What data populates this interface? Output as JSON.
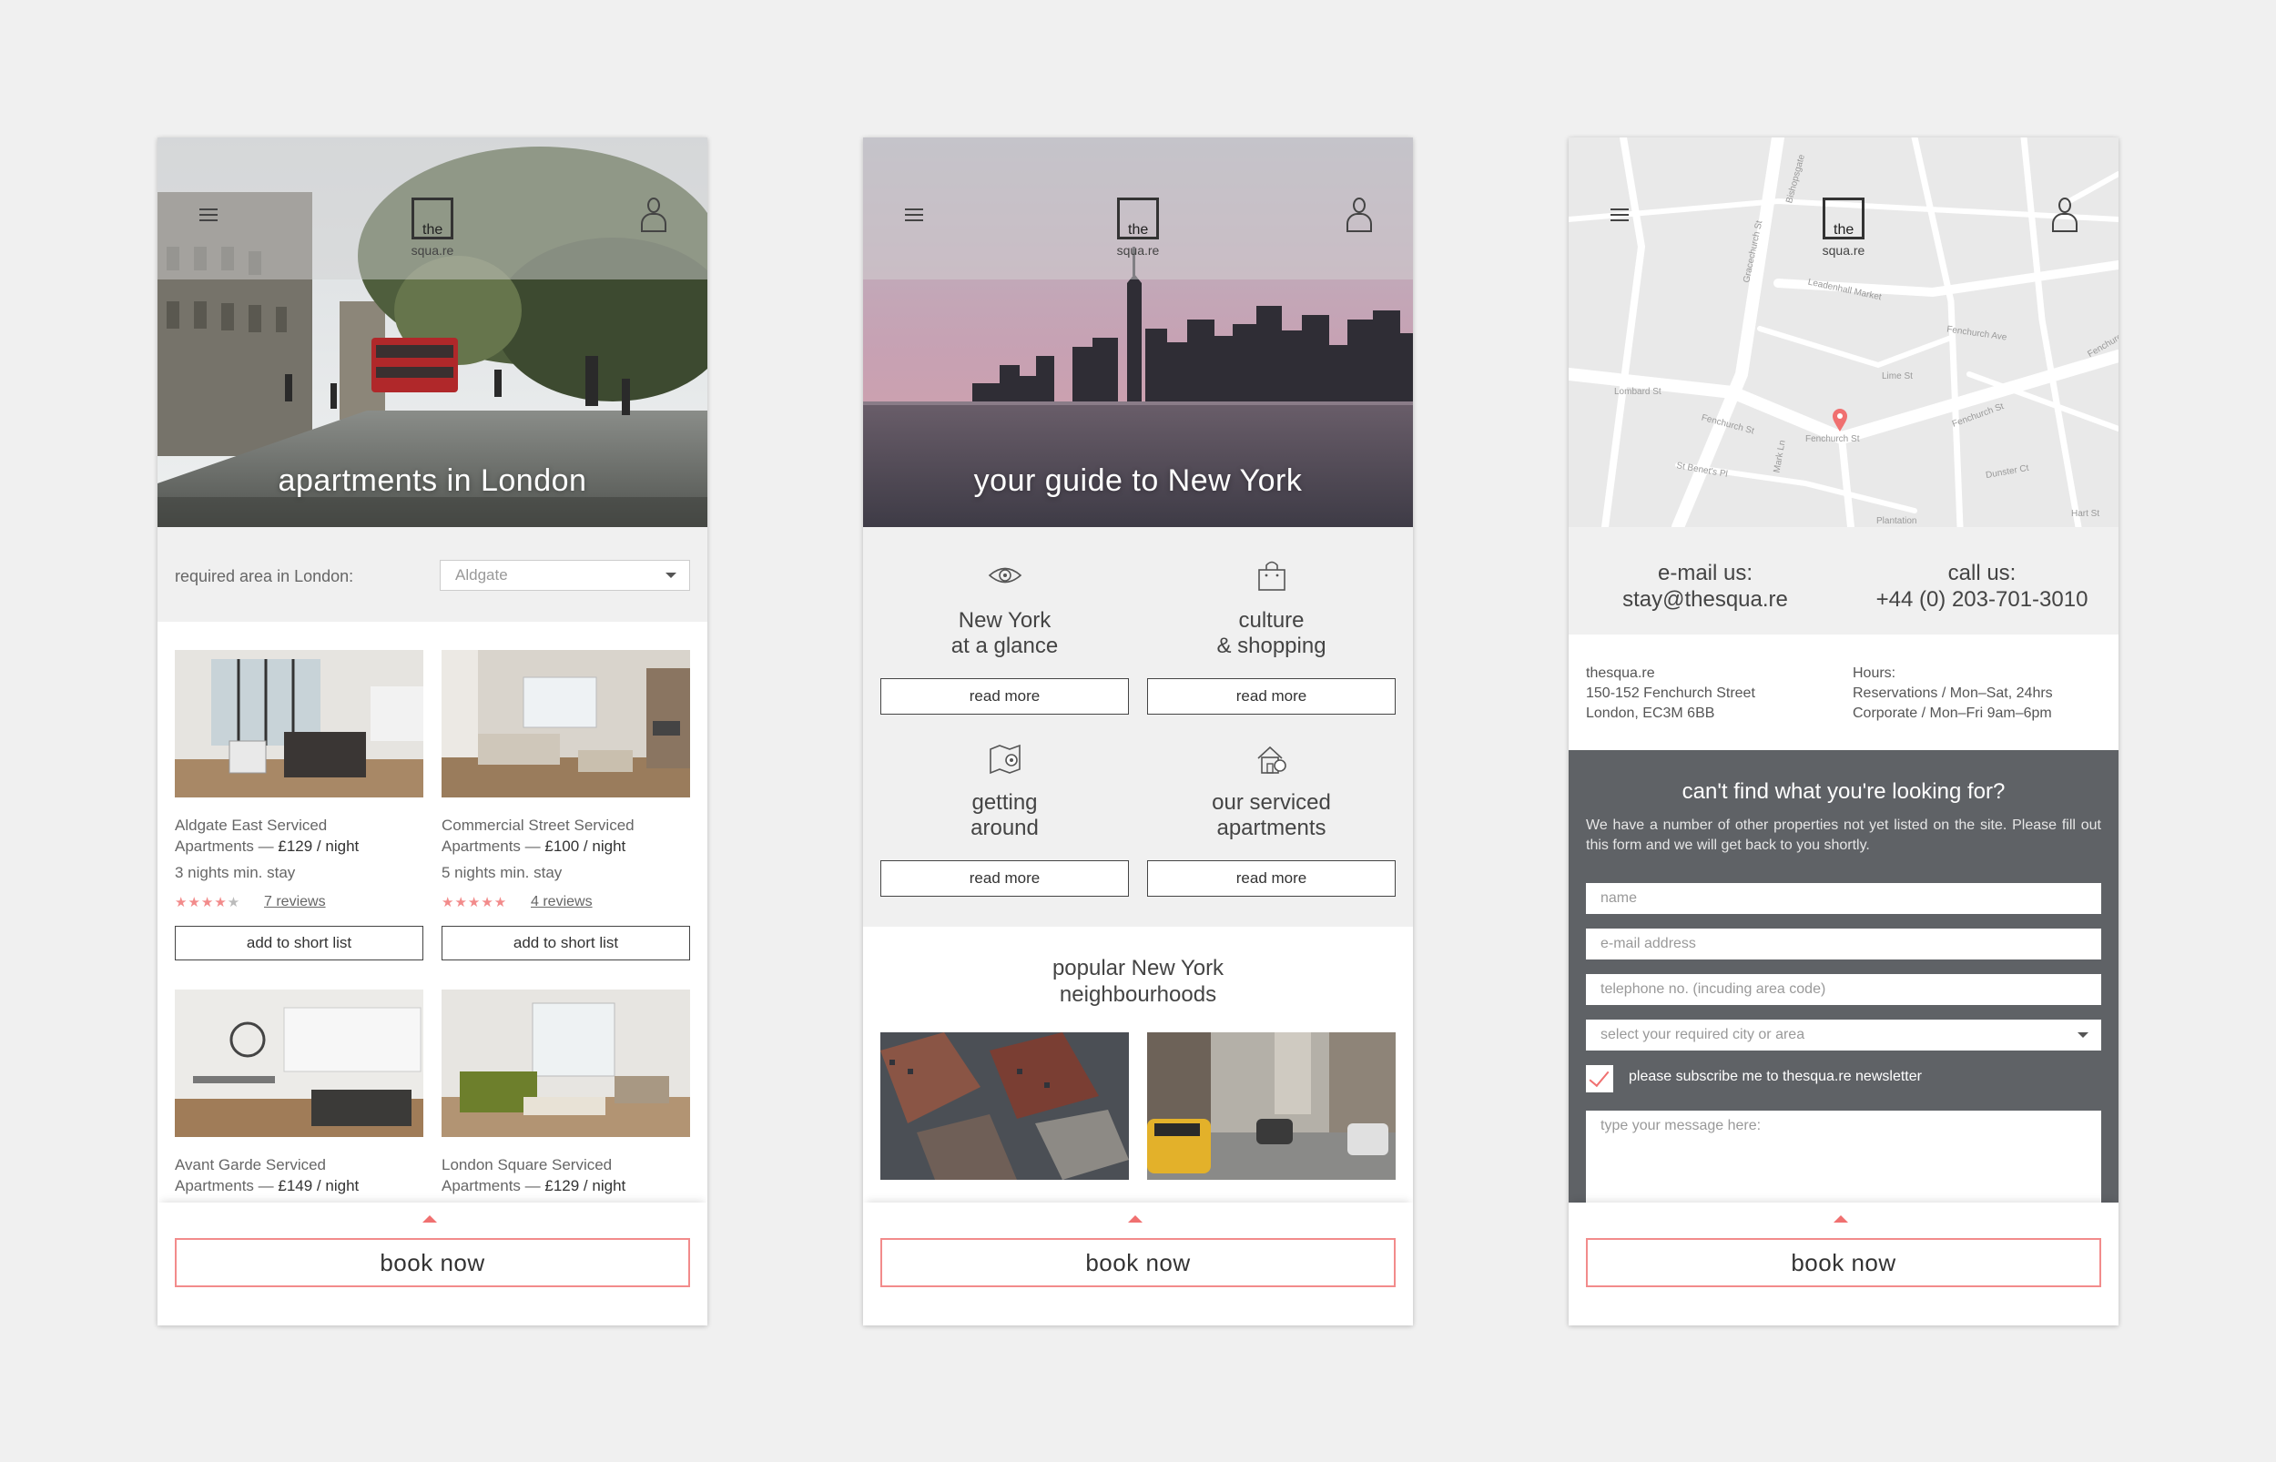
{
  "london": {
    "hero_title": "apartments in London",
    "logo_the": "the",
    "logo_rest": "squa.re",
    "area_label": "required area in London:",
    "area_value": "Aldgate",
    "cards": [
      {
        "name": "Aldgate East Serviced",
        "name2": "Apartments —",
        "price": "£129 / night",
        "stay": "3 nights min. stay",
        "stars": "★★★★",
        "star_off": "★",
        "reviews": "7 reviews",
        "btn": "add to short list"
      },
      {
        "name": "Commercial Street Serviced",
        "name2": "Apartments —",
        "price": "£100 / night",
        "stay": "5 nights min. stay",
        "stars": "★★★★★",
        "star_off": "",
        "reviews": "4 reviews",
        "btn": "add to short list"
      },
      {
        "name": "Avant Garde Serviced",
        "name2": "Apartments —",
        "price": "£149 / night"
      },
      {
        "name": "London Square Serviced",
        "name2": "Apartments —",
        "price": "£129 / night"
      }
    ],
    "book": "book now"
  },
  "newyork": {
    "hero_title": "your guide to New York",
    "logo_the": "the",
    "logo_rest": "squa.re",
    "items": [
      {
        "line1": "New York",
        "line2": "at a glance",
        "btn": "read more"
      },
      {
        "line1": "culture",
        "line2": "& shopping",
        "btn": "read more"
      },
      {
        "line1": "getting",
        "line2": "around",
        "btn": "read more"
      },
      {
        "line1": "our serviced",
        "line2": "apartments",
        "btn": "read more"
      }
    ],
    "popular1": "popular New York",
    "popular2": "neighbourhoods",
    "book": "book now"
  },
  "contact": {
    "logo_the": "the",
    "logo_rest": "squa.re",
    "map_labels": [
      "Bishopsgate",
      "Leadenhall Market",
      "Gracechurch St",
      "Lime St",
      "Fenchurch Ave",
      "Fenchurch St",
      "Fenchurch St",
      "Fenchurch St",
      "Lombard St",
      "St Benet's Pl",
      "Mark Ln",
      "Plantation",
      "Dunster Ct",
      "Hart St",
      "Fenchurch"
    ],
    "email_label": "e-mail us:",
    "email": "stay@thesqua.re",
    "call_label": "call us:",
    "phone": "+44 (0) 203-701-3010",
    "addr1": "thesqua.re",
    "addr2": "150-152 Fenchurch Street",
    "addr3": "London, EC3M 6BB",
    "hours1": "Hours:",
    "hours2": "Reservations / Mon–Sat, 24hrs",
    "hours3": "Corporate / Mon–Fri 9am–6pm",
    "form_title": "can't find what you're looking for?",
    "form_text": "We have a number of other properties not yet listed on the site. Please fill out this form and we will get back to you shortly.",
    "ph_name": "name",
    "ph_email": "e-mail address",
    "ph_tel": "telephone no. (incuding area code)",
    "ph_city": "select your required city or area",
    "subscribe": "please subscribe me to thesqua.re newsletter",
    "ph_msg": "type your message here:",
    "book": "book now"
  },
  "colors": {
    "accent": "#f28b8b",
    "form_bg": "#5f6266",
    "grey_bg": "#f0f0f0"
  }
}
